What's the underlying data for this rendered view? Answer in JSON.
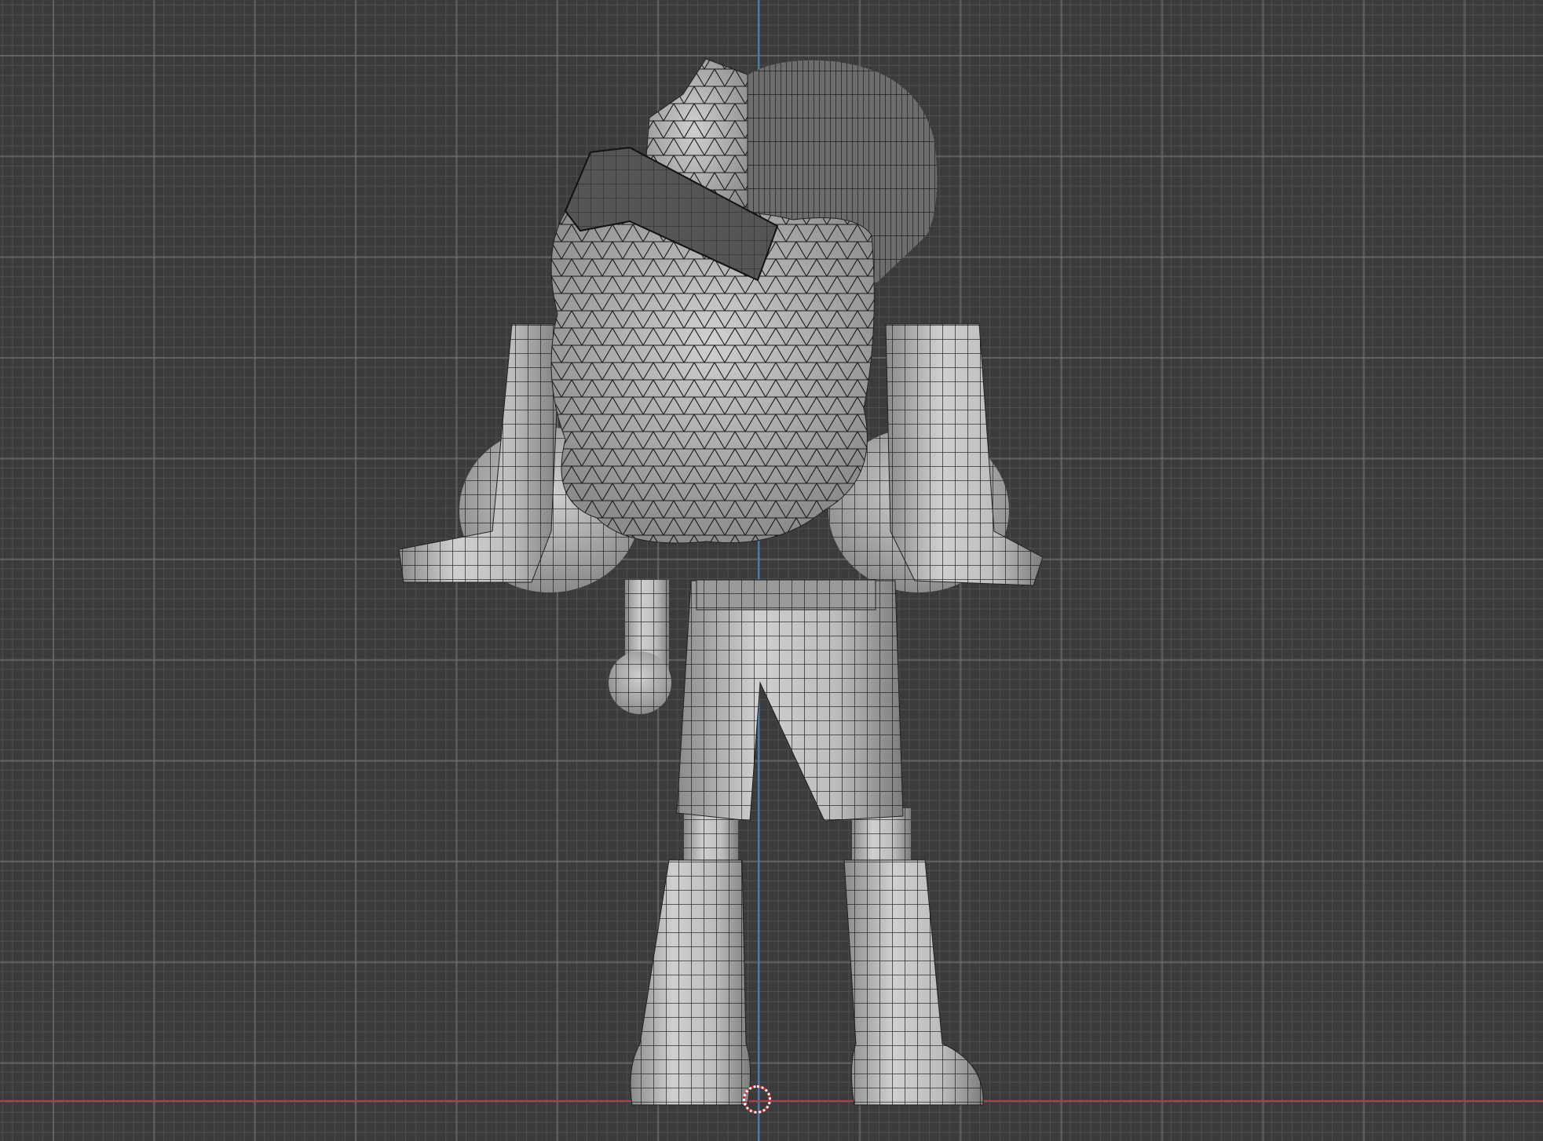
{
  "viewport": {
    "background_color": "#3b3b3b",
    "x_axis_color": "#a8414b",
    "z_axis_color": "#4a78b8",
    "cursor_colors": [
      "#e02020",
      "#ffffff"
    ],
    "mesh_color": "#b5b5b5",
    "wire_color": "#111111"
  }
}
